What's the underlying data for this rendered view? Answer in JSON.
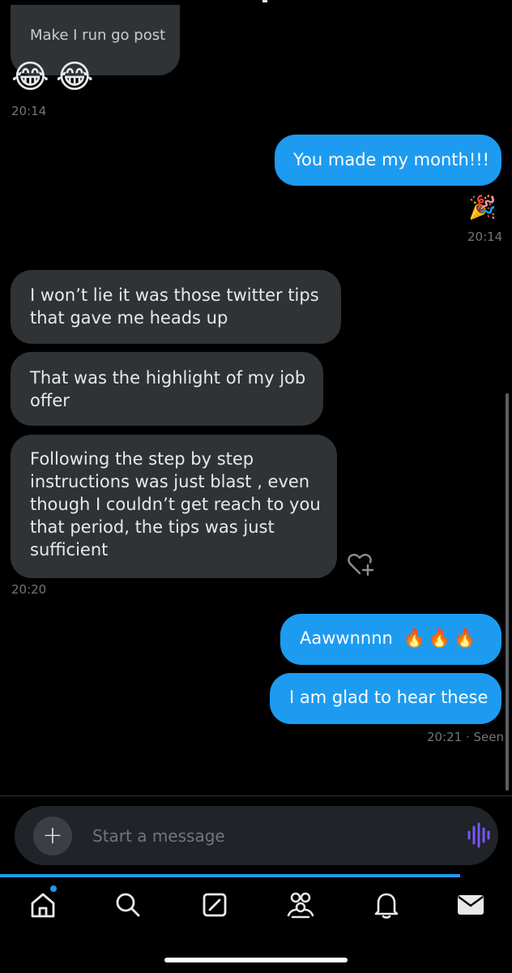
{
  "conversation": {
    "messages": [
      {
        "id": "m1",
        "direction": "incoming",
        "text": "Make I run go post"
      },
      {
        "id": "m2",
        "direction": "incoming",
        "text": "😂😂"
      },
      {
        "id": "m3",
        "direction": "outgoing",
        "text": "You made my month!!!"
      },
      {
        "id": "m4",
        "direction": "outgoing",
        "text": "🎉"
      },
      {
        "id": "m5",
        "direction": "incoming",
        "lines": [
          "I won’t lie  it was those twitter tips",
          "that gave me heads up"
        ]
      },
      {
        "id": "m6",
        "direction": "incoming",
        "lines": [
          "That was the highlight of my job",
          "offer"
        ]
      },
      {
        "id": "m7",
        "direction": "incoming",
        "lines": [
          "Following the step by step",
          "instructions was just blast , even",
          "though I couldn’t get reach to you",
          "that period, the tips was just",
          "sufficient"
        ]
      },
      {
        "id": "m8",
        "direction": "outgoing",
        "text": "Aawwnnnn",
        "emoji": "🔥🔥🔥"
      },
      {
        "id": "m9",
        "direction": "outgoing",
        "text": "I am glad to hear these"
      }
    ],
    "timestamps": {
      "t1": "20:14",
      "t2": "20:14",
      "t3": "20:20",
      "t4": "20:21 · Seen"
    }
  },
  "composer": {
    "placeholder": "Start a message",
    "add_icon": "plus-icon",
    "voice_icon": "voice-waveform-icon",
    "accent_color": "#7856ff"
  },
  "bottom_nav": {
    "items": [
      {
        "name": "home",
        "icon": "home-icon",
        "active": true,
        "has_notification_dot": true
      },
      {
        "name": "search",
        "icon": "search-icon"
      },
      {
        "name": "grok",
        "icon": "grok-icon"
      },
      {
        "name": "communities",
        "icon": "communities-icon"
      },
      {
        "name": "notifications",
        "icon": "bell-icon"
      },
      {
        "name": "messages",
        "icon": "mail-icon",
        "active": true
      }
    ]
  },
  "theme": {
    "background": "#000000",
    "incoming_bubble": "#2f3336",
    "outgoing_bubble": "#1d9bf0",
    "timestamp_color": "#71767b"
  }
}
